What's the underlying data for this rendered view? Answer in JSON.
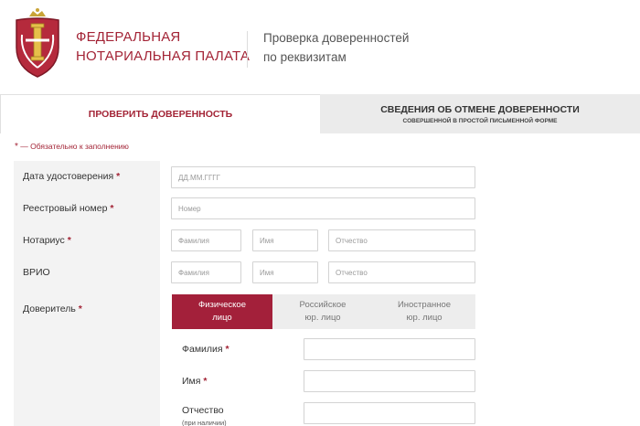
{
  "header": {
    "org_line1": "Федеральная",
    "org_line2": "нотариальная палата",
    "heading_line1": "Проверка доверенностей",
    "heading_line2": "по реквизитам",
    "logo_icon": "notary-emblem-icon",
    "brand_color": "#a32436"
  },
  "tabs": [
    {
      "label": "Проверить доверенность",
      "active": true
    },
    {
      "label": "Сведения об отмене доверенности",
      "sublabel": "совершенной в простой письменной форме",
      "active": false
    }
  ],
  "required_note": {
    "star": "*",
    "text": " — Обязательно к заполнению"
  },
  "form": {
    "required_star": "*",
    "date": {
      "label": "Дата удостоверения",
      "placeholder": "ДД.ММ.ГГГГ"
    },
    "registry": {
      "label": "Реестровый номер",
      "placeholder": "Номер"
    },
    "notary": {
      "label": "Нотариус",
      "surname_placeholder": "Фамилия",
      "name_placeholder": "Имя",
      "patronymic_placeholder": "Отчество"
    },
    "vrio": {
      "label": "ВРИО",
      "surname_placeholder": "Фамилия",
      "name_placeholder": "Имя",
      "patronymic_placeholder": "Отчество"
    },
    "principal": {
      "label": "Доверитель",
      "options": [
        "Физическое\nлицо",
        "Российское\nюр. лицо",
        "Иностранное\nюр. лицо"
      ],
      "selected_index": 0,
      "surname_label": "Фамилия",
      "name_label": "Имя",
      "patronymic_label": "Отчество",
      "patronymic_hint": "(при наличии)"
    }
  }
}
